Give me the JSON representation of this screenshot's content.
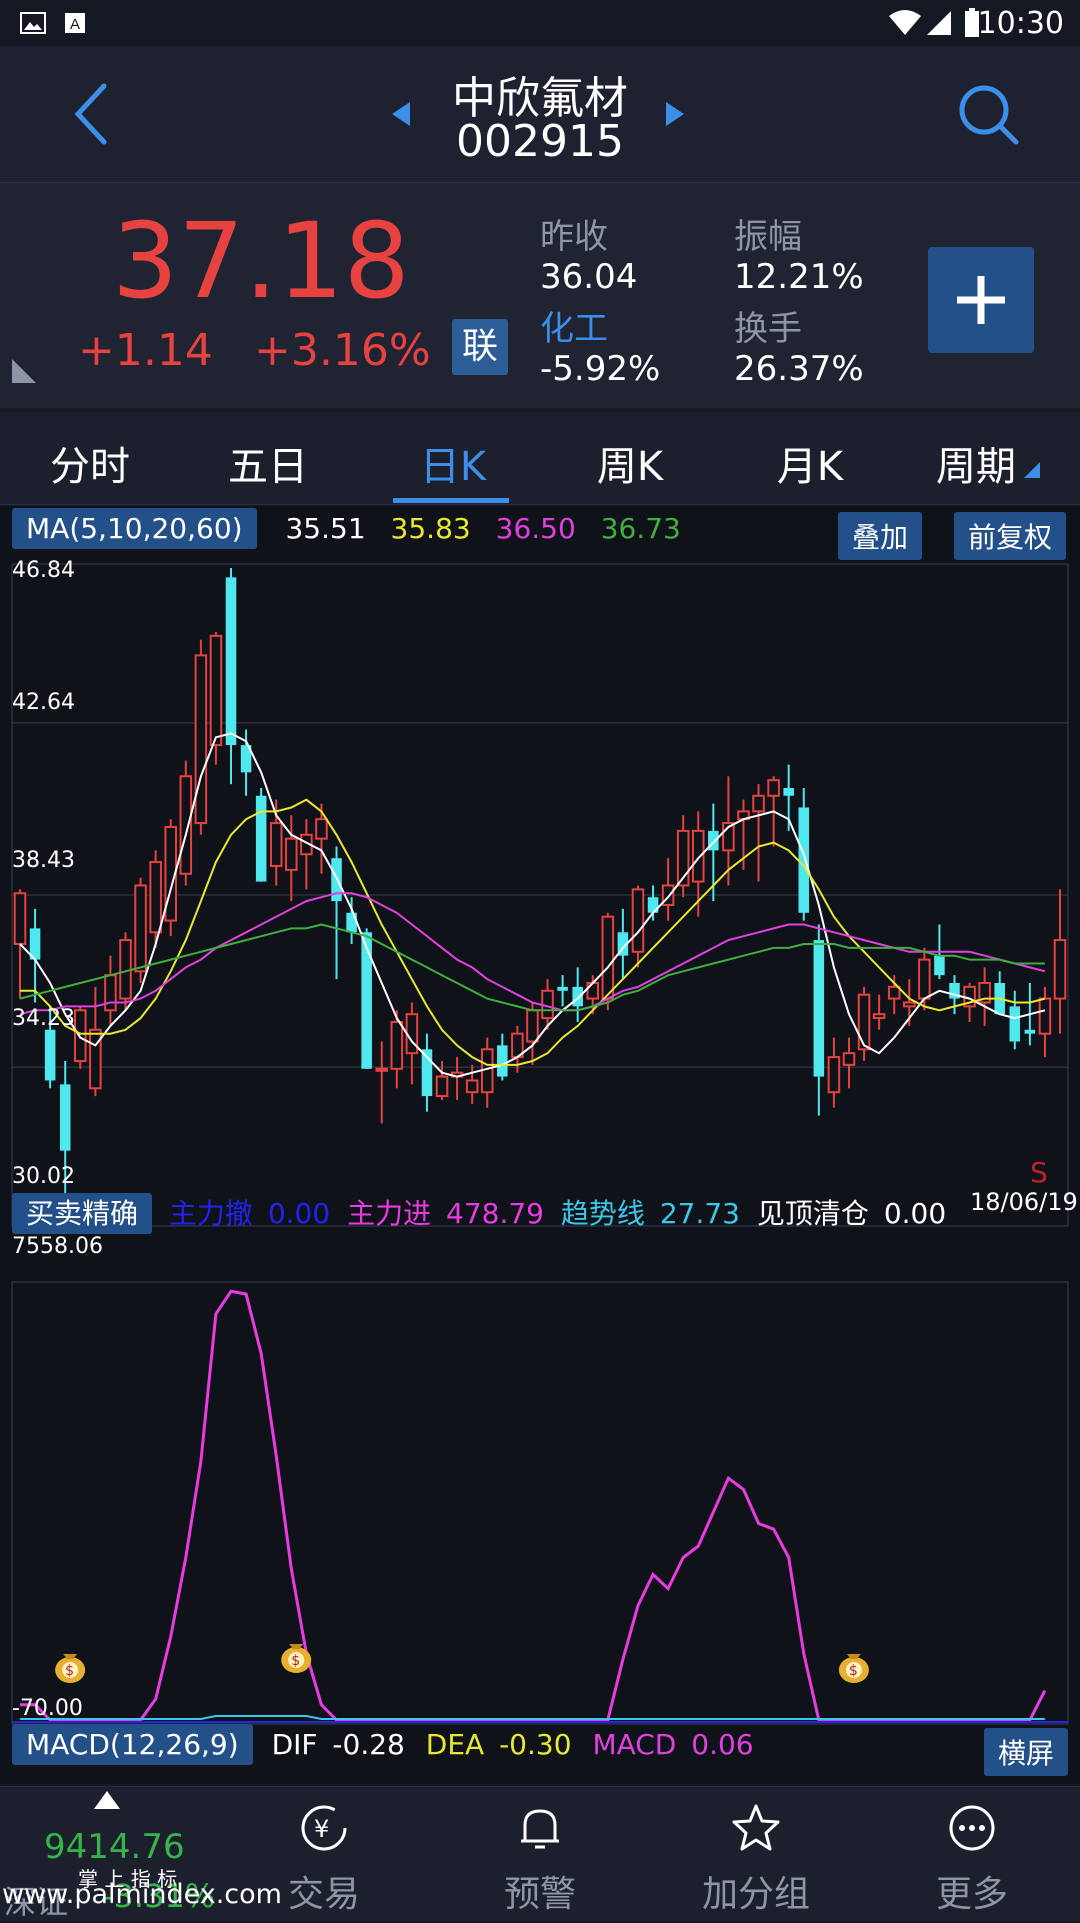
{
  "status_bar": {
    "time": "10:30"
  },
  "header": {
    "name": "中欣氟材",
    "code": "002915"
  },
  "quote": {
    "price": "37.18",
    "change": "+1.14",
    "change_pct": "+3.16%",
    "badge": "联",
    "prev_close_label": "昨收",
    "prev_close": "36.04",
    "amplitude_label": "振幅",
    "amplitude": "12.21%",
    "sector_label": "化工",
    "sector_change": "-5.92%",
    "turnover_label": "换手",
    "turnover": "26.37%"
  },
  "tabs": [
    "分时",
    "五日",
    "日K",
    "周K",
    "月K",
    "周期"
  ],
  "active_tab": 2,
  "ma_legend": {
    "label": "MA(5,10,20,60)",
    "ma5": "35.51",
    "ma10": "35.83",
    "ma20": "36.50",
    "ma60": "36.73",
    "overlay_btn": "叠加",
    "adjust_btn": "前复权"
  },
  "price_axis": [
    "46.84",
    "42.64",
    "38.43",
    "34.23",
    "30.02"
  ],
  "signal_mark": "S",
  "date_label": "18/06/19",
  "indicator_legend": {
    "label": "买卖精确",
    "withdraw_label": "主力撤",
    "withdraw_val": "0.00",
    "enter_label": "主力进",
    "enter_val": "478.79",
    "trend_label": "趋势线",
    "trend_val": "27.73",
    "top_label": "见顶清仓",
    "top_val": "0.00"
  },
  "indicator_axis": {
    "max": "7558.06",
    "min": "-70.00"
  },
  "macd_legend": {
    "label": "MACD(12,26,9)",
    "dif_label": "DIF",
    "dif": "-0.28",
    "dea_label": "DEA",
    "dea": "-0.30",
    "macd_label": "MACD",
    "macd": "0.06",
    "landscape_btn": "横屏"
  },
  "index_ticker": {
    "value": "9414.76",
    "name": "深证",
    "change": "-3.31%"
  },
  "watermark": {
    "text1": "掌 上 指 标",
    "text2": "www.palmindex.com"
  },
  "bottom_nav": [
    "交易",
    "预警",
    "加分组",
    "更多"
  ],
  "colors": {
    "up": "#e64340",
    "down": "#4fe8ee",
    "ma5": "#ffffff",
    "ma10": "#e8e830",
    "ma20": "#e040e0",
    "ma60": "#3fae3f",
    "accent": "#3d8ee8",
    "enter_line": "#e83ce0"
  },
  "chart_data": {
    "type": "candlestick",
    "ylim": [
      30.02,
      46.84
    ],
    "candles": [
      {
        "o": 37.2,
        "h": 38.6,
        "l": 35.8,
        "c": 38.5
      },
      {
        "o": 37.6,
        "h": 38.1,
        "l": 35.7,
        "c": 36.8
      },
      {
        "o": 35.0,
        "h": 35.6,
        "l": 33.5,
        "c": 33.7
      },
      {
        "o": 33.6,
        "h": 34.2,
        "l": 30.0,
        "c": 31.9
      },
      {
        "o": 34.2,
        "h": 35.6,
        "l": 34.0,
        "c": 35.5
      },
      {
        "o": 33.5,
        "h": 36.1,
        "l": 33.3,
        "c": 35.0
      },
      {
        "o": 35.5,
        "h": 36.9,
        "l": 35.1,
        "c": 36.4
      },
      {
        "o": 35.8,
        "h": 37.5,
        "l": 35.5,
        "c": 37.3
      },
      {
        "o": 36.5,
        "h": 38.9,
        "l": 36.2,
        "c": 38.7
      },
      {
        "o": 37.5,
        "h": 39.6,
        "l": 37.1,
        "c": 39.3
      },
      {
        "o": 37.8,
        "h": 40.4,
        "l": 37.4,
        "c": 40.2
      },
      {
        "o": 39.0,
        "h": 41.9,
        "l": 38.7,
        "c": 41.5
      },
      {
        "o": 40.3,
        "h": 45.0,
        "l": 40.0,
        "c": 44.6
      },
      {
        "o": 42.3,
        "h": 45.2,
        "l": 41.8,
        "c": 45.1
      },
      {
        "o": 46.6,
        "h": 46.84,
        "l": 41.3,
        "c": 42.3
      },
      {
        "o": 42.3,
        "h": 42.7,
        "l": 41.0,
        "c": 41.6
      },
      {
        "o": 41.0,
        "h": 41.2,
        "l": 38.8,
        "c": 38.8
      },
      {
        "o": 39.2,
        "h": 40.9,
        "l": 38.7,
        "c": 40.3
      },
      {
        "o": 39.1,
        "h": 40.5,
        "l": 38.3,
        "c": 39.9
      },
      {
        "o": 39.5,
        "h": 40.4,
        "l": 38.6,
        "c": 40.0
      },
      {
        "o": 39.9,
        "h": 40.8,
        "l": 39.0,
        "c": 40.4
      },
      {
        "o": 39.4,
        "h": 39.7,
        "l": 36.3,
        "c": 38.3
      },
      {
        "o": 38.0,
        "h": 38.4,
        "l": 37.2,
        "c": 37.5
      },
      {
        "o": 37.5,
        "h": 37.6,
        "l": 34.0,
        "c": 34.0
      },
      {
        "o": 34.0,
        "h": 34.7,
        "l": 32.6,
        "c": 34.0
      },
      {
        "o": 34.0,
        "h": 35.5,
        "l": 33.5,
        "c": 35.2
      },
      {
        "o": 34.4,
        "h": 35.7,
        "l": 33.6,
        "c": 35.4
      },
      {
        "o": 34.5,
        "h": 34.9,
        "l": 32.9,
        "c": 33.3
      },
      {
        "o": 33.3,
        "h": 34.2,
        "l": 33.2,
        "c": 33.8
      },
      {
        "o": 33.8,
        "h": 34.3,
        "l": 33.2,
        "c": 33.9
      },
      {
        "o": 33.4,
        "h": 34.1,
        "l": 33.1,
        "c": 33.7
      },
      {
        "o": 33.4,
        "h": 34.8,
        "l": 33.0,
        "c": 34.5
      },
      {
        "o": 34.6,
        "h": 34.9,
        "l": 33.7,
        "c": 33.8
      },
      {
        "o": 34.3,
        "h": 35.1,
        "l": 33.9,
        "c": 34.9
      },
      {
        "o": 34.7,
        "h": 35.7,
        "l": 34.1,
        "c": 35.5
      },
      {
        "o": 35.3,
        "h": 36.3,
        "l": 35.0,
        "c": 36.0
      },
      {
        "o": 36.1,
        "h": 36.4,
        "l": 35.6,
        "c": 36.0
      },
      {
        "o": 36.1,
        "h": 36.6,
        "l": 35.2,
        "c": 35.6
      },
      {
        "o": 35.8,
        "h": 36.4,
        "l": 35.4,
        "c": 36.2
      },
      {
        "o": 35.8,
        "h": 38.0,
        "l": 35.5,
        "c": 37.9
      },
      {
        "o": 37.5,
        "h": 38.1,
        "l": 36.3,
        "c": 36.9
      },
      {
        "o": 37.0,
        "h": 38.7,
        "l": 36.6,
        "c": 38.6
      },
      {
        "o": 38.4,
        "h": 38.7,
        "l": 37.8,
        "c": 38.0
      },
      {
        "o": 38.2,
        "h": 39.4,
        "l": 37.8,
        "c": 38.7
      },
      {
        "o": 38.7,
        "h": 40.5,
        "l": 38.4,
        "c": 40.1
      },
      {
        "o": 38.8,
        "h": 40.6,
        "l": 37.9,
        "c": 40.1
      },
      {
        "o": 40.1,
        "h": 40.8,
        "l": 38.3,
        "c": 39.6
      },
      {
        "o": 39.6,
        "h": 41.5,
        "l": 38.7,
        "c": 40.3
      },
      {
        "o": 40.4,
        "h": 40.9,
        "l": 39.1,
        "c": 40.6
      },
      {
        "o": 40.6,
        "h": 41.3,
        "l": 38.8,
        "c": 41.0
      },
      {
        "o": 41.0,
        "h": 41.5,
        "l": 39.7,
        "c": 41.4
      },
      {
        "o": 41.2,
        "h": 41.8,
        "l": 40.1,
        "c": 41.0
      },
      {
        "o": 40.7,
        "h": 41.2,
        "l": 37.8,
        "c": 38.0
      },
      {
        "o": 37.3,
        "h": 37.7,
        "l": 32.8,
        "c": 33.8
      },
      {
        "o": 33.4,
        "h": 34.8,
        "l": 33.0,
        "c": 34.3
      },
      {
        "o": 34.1,
        "h": 34.8,
        "l": 33.5,
        "c": 34.4
      },
      {
        "o": 34.5,
        "h": 36.1,
        "l": 34.2,
        "c": 35.9
      },
      {
        "o": 35.3,
        "h": 35.9,
        "l": 35.0,
        "c": 35.4
      },
      {
        "o": 35.8,
        "h": 36.4,
        "l": 35.4,
        "c": 36.1
      },
      {
        "o": 35.6,
        "h": 36.3,
        "l": 35.1,
        "c": 35.7
      },
      {
        "o": 35.8,
        "h": 37.1,
        "l": 35.5,
        "c": 36.8
      },
      {
        "o": 36.9,
        "h": 37.7,
        "l": 36.3,
        "c": 36.4
      },
      {
        "o": 36.2,
        "h": 36.4,
        "l": 35.4,
        "c": 35.8
      },
      {
        "o": 35.6,
        "h": 36.2,
        "l": 35.2,
        "c": 36.1
      },
      {
        "o": 35.7,
        "h": 36.6,
        "l": 35.1,
        "c": 36.2
      },
      {
        "o": 36.2,
        "h": 36.5,
        "l": 35.4,
        "c": 35.4
      },
      {
        "o": 35.6,
        "h": 36.0,
        "l": 34.5,
        "c": 34.7
      },
      {
        "o": 35.0,
        "h": 36.2,
        "l": 34.6,
        "c": 34.9
      },
      {
        "o": 34.9,
        "h": 36.1,
        "l": 34.3,
        "c": 35.8
      },
      {
        "o": 35.8,
        "h": 38.6,
        "l": 34.9,
        "c": 37.3
      }
    ],
    "ma_lines": {
      "ma5": [
        37.2,
        36.8,
        36.2,
        35.4,
        34.8,
        34.6,
        35.1,
        35.5,
        36.0,
        37.2,
        38.6,
        40.0,
        41.5,
        42.5,
        42.6,
        42.4,
        41.6,
        40.5,
        40.0,
        39.8,
        39.6,
        38.9,
        38.1,
        37.1,
        36.2,
        35.3,
        34.7,
        34.3,
        33.9,
        33.8,
        33.9,
        34.0,
        34.1,
        34.3,
        34.6,
        35.1,
        35.5,
        35.8,
        36.2,
        36.6,
        37.1,
        37.5,
        38.0,
        38.4,
        38.9,
        39.4,
        39.8,
        40.2,
        40.4,
        40.5,
        40.6,
        40.4,
        39.5,
        38.2,
        36.6,
        35.4,
        34.6,
        34.4,
        34.8,
        35.3,
        35.8,
        36.0,
        35.9,
        35.8,
        35.6,
        35.4,
        35.3,
        35.4,
        35.5
      ],
      "ma10": [
        36.0,
        36.0,
        35.6,
        35.1,
        34.9,
        34.9,
        34.9,
        35.0,
        35.3,
        35.8,
        36.5,
        37.3,
        38.3,
        39.3,
        40.0,
        40.4,
        40.6,
        40.6,
        40.7,
        40.9,
        40.6,
        40.0,
        39.3,
        38.5,
        37.7,
        37.0,
        36.3,
        35.6,
        35.0,
        34.6,
        34.3,
        34.1,
        34.1,
        34.1,
        34.2,
        34.4,
        34.8,
        35.1,
        35.5,
        35.9,
        36.3,
        36.7,
        37.1,
        37.5,
        37.9,
        38.3,
        38.7,
        39.1,
        39.4,
        39.7,
        39.8,
        39.6,
        39.2,
        38.6,
        37.9,
        37.4,
        37.0,
        36.6,
        36.2,
        35.8,
        35.6,
        35.5,
        35.6,
        35.7,
        35.8,
        35.8,
        35.7,
        35.7,
        35.8
      ],
      "ma20": [
        35.4,
        35.5,
        35.5,
        35.6,
        35.6,
        35.6,
        35.7,
        35.7,
        35.8,
        36.0,
        36.3,
        36.6,
        36.8,
        37.1,
        37.3,
        37.5,
        37.7,
        37.9,
        38.1,
        38.3,
        38.4,
        38.5,
        38.5,
        38.4,
        38.2,
        38.0,
        37.7,
        37.4,
        37.1,
        36.8,
        36.6,
        36.3,
        36.1,
        35.9,
        35.7,
        35.6,
        35.5,
        35.5,
        35.6,
        35.8,
        36.0,
        36.1,
        36.3,
        36.5,
        36.7,
        36.9,
        37.1,
        37.3,
        37.4,
        37.5,
        37.6,
        37.7,
        37.7,
        37.6,
        37.5,
        37.4,
        37.3,
        37.2,
        37.1,
        37.0,
        37.0,
        37.0,
        37.0,
        37.0,
        36.9,
        36.8,
        36.7,
        36.6,
        36.5
      ],
      "ma60": [
        35.8,
        35.9,
        36.0,
        36.1,
        36.2,
        36.3,
        36.4,
        36.5,
        36.6,
        36.7,
        36.8,
        36.9,
        37.0,
        37.1,
        37.2,
        37.3,
        37.4,
        37.5,
        37.6,
        37.6,
        37.7,
        37.6,
        37.5,
        37.4,
        37.2,
        37.0,
        36.8,
        36.6,
        36.4,
        36.2,
        36.0,
        35.8,
        35.7,
        35.6,
        35.5,
        35.5,
        35.5,
        35.5,
        35.6,
        35.7,
        35.9,
        36.0,
        36.2,
        36.4,
        36.5,
        36.6,
        36.7,
        36.8,
        36.9,
        37.0,
        37.1,
        37.1,
        37.2,
        37.2,
        37.2,
        37.1,
        37.1,
        37.1,
        37.1,
        37.1,
        37.0,
        36.9,
        36.9,
        36.8,
        36.8,
        36.8,
        36.7,
        36.7,
        36.7
      ]
    },
    "indicator": {
      "ylim": [
        -70.0,
        7558.06
      ],
      "enter_line": [
        200,
        200,
        -70,
        -70,
        -70,
        -70,
        -70,
        -70,
        -70,
        300,
        1400,
        2800,
        4500,
        7100,
        7500,
        7450,
        6400,
        4600,
        2600,
        1100,
        200,
        -70,
        -70,
        -70,
        -70,
        -70,
        -70,
        -70,
        -70,
        -70,
        -70,
        -70,
        -70,
        -70,
        -70,
        -70,
        -70,
        -70,
        -70,
        -70,
        1000,
        1950,
        2500,
        2250,
        2800,
        3000,
        3600,
        4200,
        4000,
        3400,
        3300,
        2800,
        1100,
        -70,
        -70,
        -70,
        -70,
        -70,
        -70,
        -70,
        -70,
        -70,
        -70,
        -70,
        -70,
        -70,
        -70,
        -70,
        450
      ],
      "money_bag_positions": [
        2,
        17,
        54
      ]
    }
  }
}
